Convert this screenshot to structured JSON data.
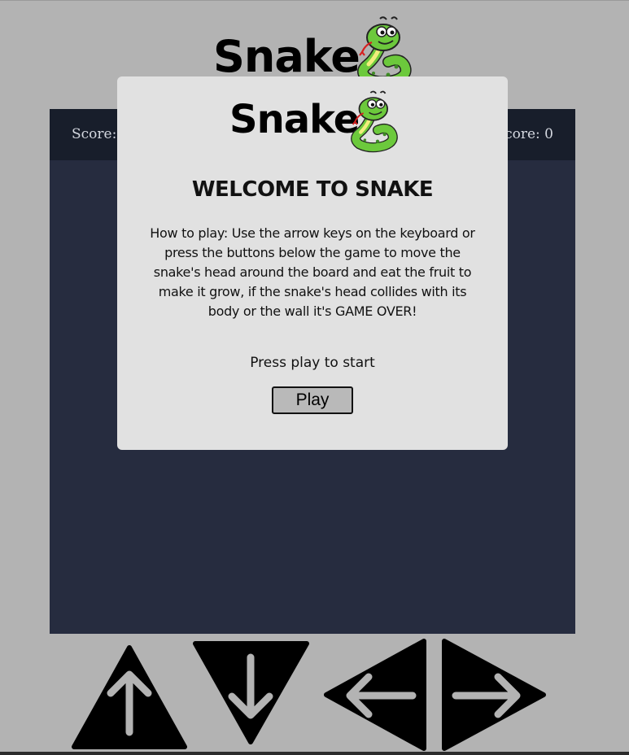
{
  "app": {
    "logo_text": "Snake"
  },
  "scoreboard": {
    "score_label": "Score:",
    "high_score_text": "High Score: 0"
  },
  "modal": {
    "logo_text": "Snake",
    "title": "WELCOME TO SNAKE",
    "instructions": "How to play: Use the arrow keys on the keyboard or press the buttons below the game to move the snake's head around the board and eat the fruit to make it grow, if the snake's head collides with its body or the wall it's GAME OVER!",
    "prompt": "Press play to start",
    "play_label": "Play"
  },
  "controls": [
    {
      "direction": "up",
      "icon": "arrow-up-icon"
    },
    {
      "direction": "down",
      "icon": "arrow-down-icon"
    },
    {
      "direction": "left",
      "icon": "arrow-left-icon"
    },
    {
      "direction": "right",
      "icon": "arrow-right-icon"
    }
  ],
  "colors": {
    "page_background": "#b3b3b3",
    "board_background": "#262c3f",
    "scorebar_background": "#181e2b",
    "modal_background": "#e1e1e1",
    "snake_green": "#6cc93c",
    "snake_belly": "#f2ee7c"
  }
}
